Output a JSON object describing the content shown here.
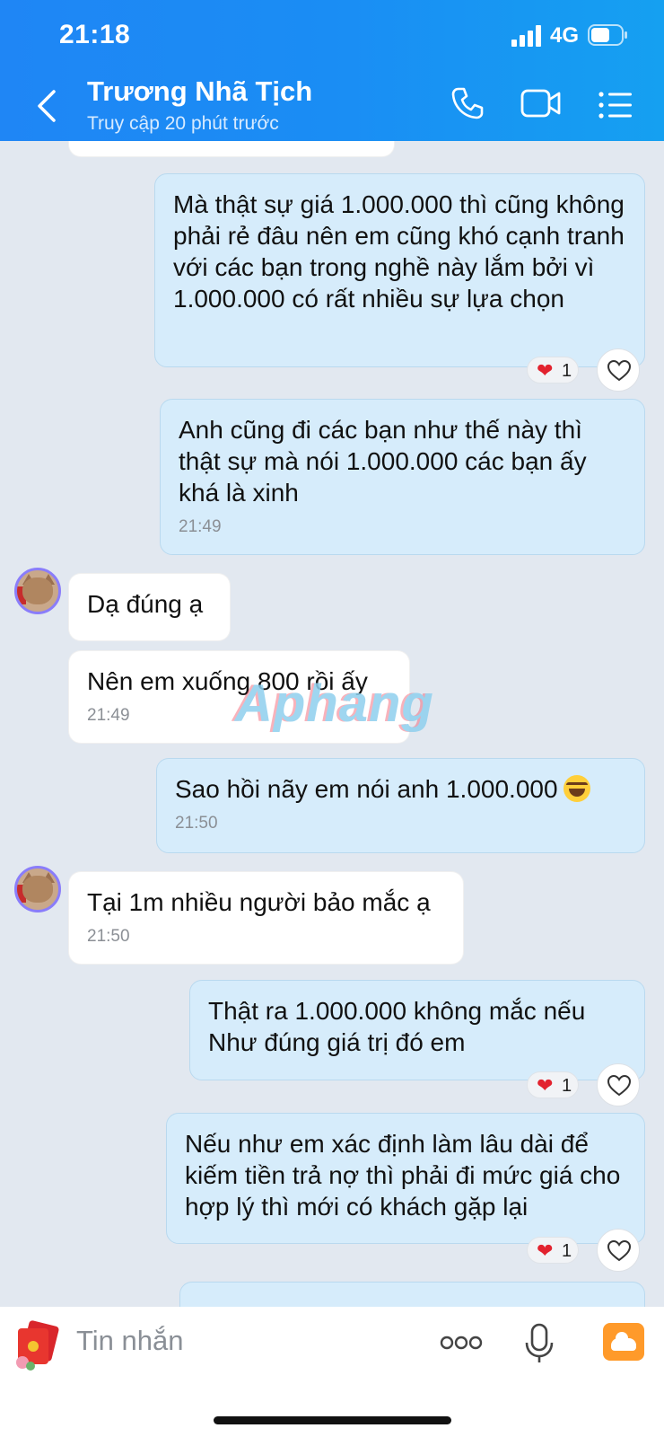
{
  "status_bar": {
    "time": "21:18",
    "network": "4G"
  },
  "header": {
    "contact_name": "Trương Nhã Tịch",
    "contact_status": "Truy cập 20 phút trước"
  },
  "messages": [
    {
      "from": "me",
      "text": "Mà thật sự giá 1.000.000 thì cũng không phải rẻ đâu nên em cũng khó cạnh tranh với các bạn trong nghề này lắm bởi vì 1.000.000 có rất nhiều sự lựa chọn",
      "reaction": {
        "emoji": "❤",
        "count": "1"
      }
    },
    {
      "from": "me",
      "text": "Anh cũng đi các bạn như thế này thì thật sự mà nói 1.000.000 các bạn ấy khá là xinh",
      "time": "21:49"
    },
    {
      "from": "them",
      "text": "Dạ đúng ạ"
    },
    {
      "from": "them",
      "text": "Nên em xuống 800 rồi ấy",
      "time": "21:49"
    },
    {
      "from": "me",
      "text": "Sao hồi nãy em nói anh 1.000.000",
      "emoji": "laughing-tears",
      "time": "21:50"
    },
    {
      "from": "them",
      "text": "Tại 1m nhiều người bảo mắc ạ",
      "time": "21:50"
    },
    {
      "from": "me",
      "text": "Thật ra 1.000.000 không mắc nếu Như đúng giá trị đó em",
      "reaction": {
        "emoji": "❤",
        "count": "1"
      }
    },
    {
      "from": "me",
      "text": "Nếu như em xác định làm lâu dài để kiếm tiền trả nợ thì phải đi mức giá cho hợp lý thì mới có khách gặp lại",
      "reaction": {
        "emoji": "❤",
        "count": "1"
      }
    }
  ],
  "watermark": "Aphang",
  "input": {
    "placeholder": "Tin nhắn"
  },
  "icons": {
    "back": "chevron-left-icon",
    "call": "phone-icon",
    "video": "video-camera-icon",
    "menu": "list-menu-icon",
    "like": "heart-outline-icon",
    "sticker": "sticker-icon",
    "more": "more-dots-icon",
    "mic": "microphone-icon",
    "photo": "photo-icon"
  },
  "colors": {
    "header": "#1a8df4",
    "my_bubble": "#d6ecfb",
    "their_bubble": "#ffffff",
    "background": "#e2e8f0",
    "heart": "#e2222e"
  }
}
